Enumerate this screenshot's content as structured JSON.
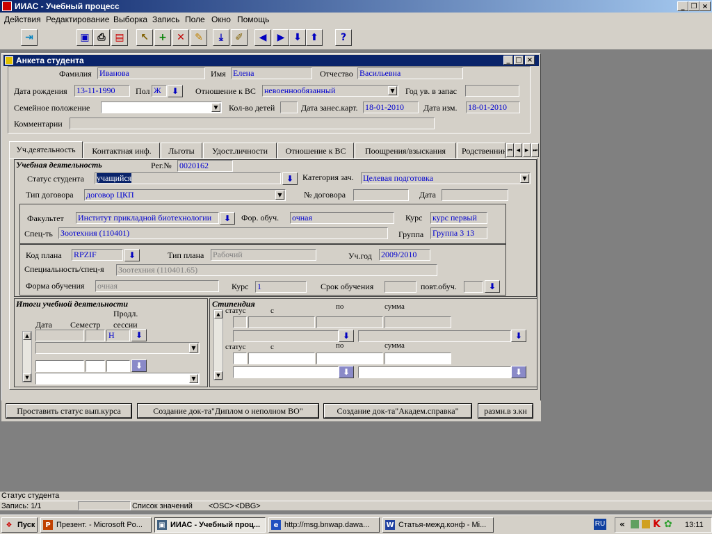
{
  "app": {
    "title": "ИИАС - Учебный процесс"
  },
  "menu": [
    "Действия",
    "Редактирование",
    "Выборка",
    "Запись",
    "Поле",
    "Окно",
    "Помощь"
  ],
  "form": {
    "title": "Анкета студента",
    "header": {
      "surname_label": "Фамилия",
      "surname": "Иванова",
      "name_label": "Имя",
      "name": "Елена",
      "patronymic_label": "Отчество",
      "patronymic": "Васильевна",
      "dob_label": "Дата рождения",
      "dob": "13-11-1990",
      "sex_label": "Пол",
      "sex": "Ж",
      "military_label": "Отношение к ВС",
      "military": "невоеннообязанный",
      "reserve_label": "Год ув. в запас",
      "reserve": "",
      "marital_label": "Семейное положение",
      "marital": "",
      "children_label": "Кол-во детей",
      "children": "",
      "card_date_label": "Дата занес.карт.",
      "card_date": "18-01-2010",
      "mod_date_label": "Дата изм.",
      "mod_date": "18-01-2010",
      "comment_label": "Комментарии",
      "comment": ""
    },
    "tabs": [
      "Уч.деятельность",
      "Контактная инф.",
      "Льготы",
      "Удост.личности",
      "Отношение к ВС",
      "Поощрения/взыскания",
      "Родственники"
    ],
    "study": {
      "section": "Учебная деятельность",
      "reg_label": "Рег.№",
      "reg": "0020162",
      "status_label": "Статус студента",
      "status": "учащийся",
      "category_label": "Категория зач.",
      "category": "Целевая подготовка",
      "contract_type_label": "Тип договора",
      "contract_type": "договор ЦКП",
      "contract_no_label": "№ договора",
      "contract_no": "",
      "date_label": "Дата",
      "date": "",
      "faculty_label": "Факультет",
      "faculty": "Институт прикладной биотехнологии",
      "form_label": "Фор. обуч.",
      "form": "очная",
      "course_label": "Курс",
      "course": "курс первый",
      "spec_label": "Спец-ть",
      "spec": "Зоотехния (110401)",
      "group_label": "Группа",
      "group": "Группа 3 13",
      "plan_code_label": "Код плана",
      "plan_code": "RPZIF",
      "plan_type_label": "Тип плана",
      "plan_type": "Рабочий",
      "year_label": "Уч.год",
      "year": "2009/2010",
      "specialty_label": "Специальность/спец-я",
      "specialty": "Зоотехния (110401.65)",
      "study_form_label": "Форма обучения",
      "study_form": "очная",
      "course2_label": "Курс",
      "course2": "1",
      "term_label": "Срок обучения",
      "term": "",
      "repeat_label": "повт.обуч."
    },
    "results": {
      "title": "Итоги учебной деятельности",
      "date_label": "Дата",
      "semester_label": "Семестр",
      "ext_label1": "Продл.",
      "ext_label2": "сессии",
      "ext_value": "Н"
    },
    "scholarship": {
      "title": "Стипендия",
      "status_label": "статус",
      "from_label": "с",
      "to_label": "по",
      "sum_label": "сумма"
    }
  },
  "buttons": [
    "Проставить статус вып.курса",
    "Создание док-та\"Диплом о неполном ВО\"",
    "Создание док-та\"Академ.справка\"",
    "размн.в з.кн"
  ],
  "statusbar": {
    "hint": "Статус студента",
    "record": "Запись: 1/1",
    "list": "Список значений",
    "osc": "<OSC>",
    "dbg": "<DBG>"
  },
  "taskbar": {
    "start": "Пуск",
    "tasks": [
      "Презент. - Microsoft Po...",
      "ИИАС - Учебный проц...",
      "http://msg.bnwap.dawa...",
      "Статья-межд.конф - Mi..."
    ],
    "lang": "RU",
    "clock": "13:11"
  }
}
